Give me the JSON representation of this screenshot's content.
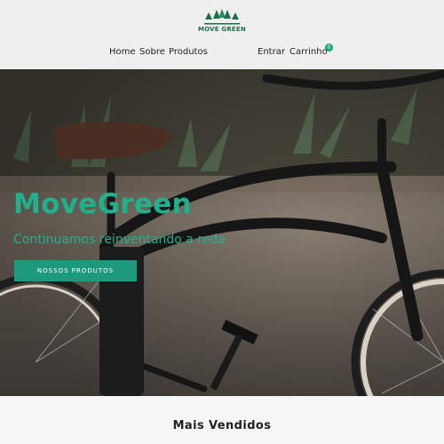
{
  "brand": {
    "name": "MOVE GREEN",
    "color": "#1f6b4a"
  },
  "nav": {
    "links": [
      "Home",
      "Sobre",
      "Produtos"
    ],
    "login": "Entrar",
    "cart": "Carrinho",
    "cart_count": "0"
  },
  "hero": {
    "title": "MoveGreen",
    "subtitle": "Continuamos reinventando a roda",
    "cta": "NOSSOS PRODUTOS",
    "accent": "#20b08c"
  },
  "section": {
    "title": "Mais Vendidos"
  }
}
